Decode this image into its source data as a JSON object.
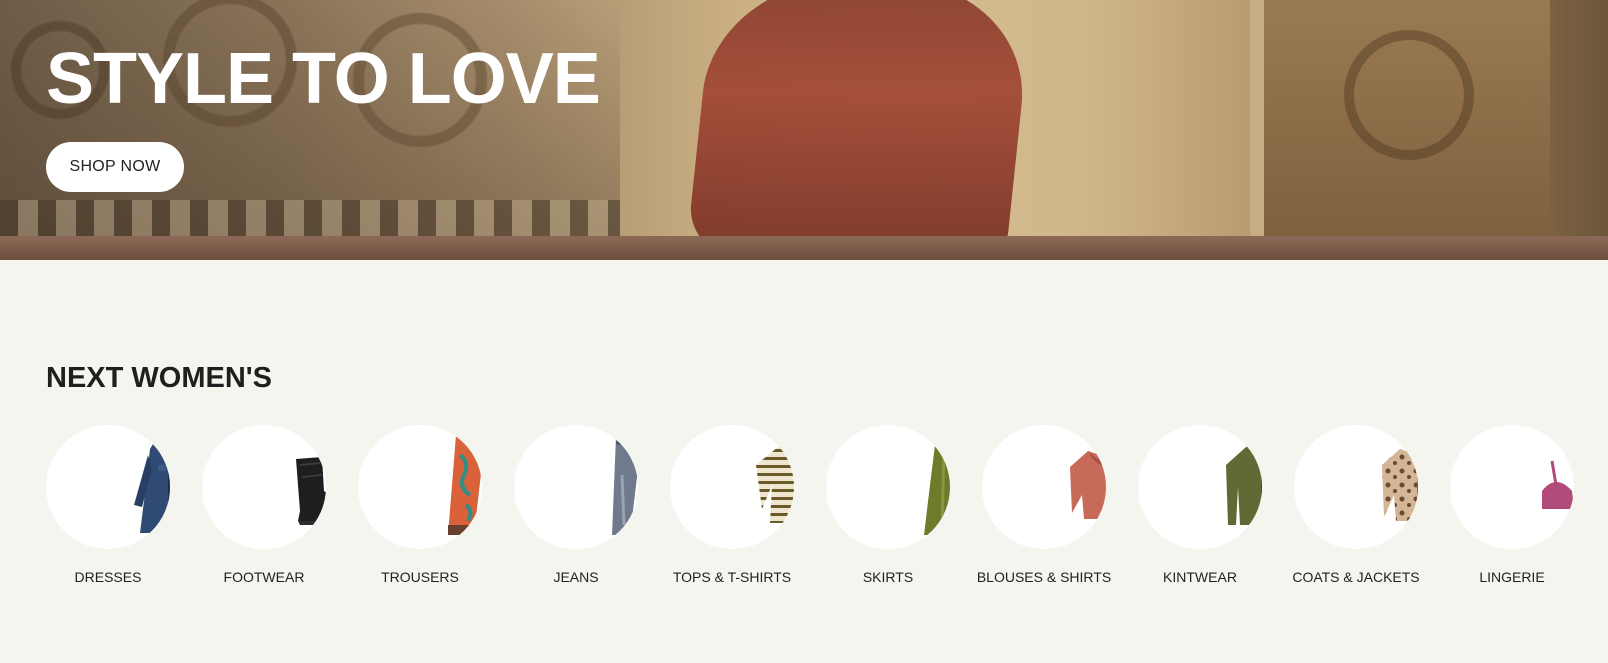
{
  "hero": {
    "title": "STYLE TO LOVE",
    "cta_label": "SHOP NOW"
  },
  "section": {
    "title": "NEXT WOMEN'S"
  },
  "categories": [
    {
      "label": "DRESSES",
      "icon": "dress-icon",
      "color": "#2f4a73"
    },
    {
      "label": "FOOTWEAR",
      "icon": "boot-icon",
      "color": "#1e1e1e"
    },
    {
      "label": "TROUSERS",
      "icon": "trousers-icon",
      "color": "#d9623a"
    },
    {
      "label": "JEANS",
      "icon": "jeans-icon",
      "color": "#6f7a8c"
    },
    {
      "label": "TOPS & T-SHIRTS",
      "icon": "striped-top-icon",
      "color": "#8a7a3a"
    },
    {
      "label": "SKIRTS",
      "icon": "skirt-icon",
      "color": "#6f7a2a"
    },
    {
      "label": "BLOUSES & SHIRTS",
      "icon": "blouse-icon",
      "color": "#c86a5a"
    },
    {
      "label": "KINTWEAR",
      "icon": "cardigan-icon",
      "color": "#5f6a35"
    },
    {
      "label": "COATS & JACKETS",
      "icon": "leopard-jacket-icon",
      "color": "#b08a6a"
    },
    {
      "label": "LINGERIE",
      "icon": "bra-icon",
      "color": "#b24a7a"
    }
  ]
}
